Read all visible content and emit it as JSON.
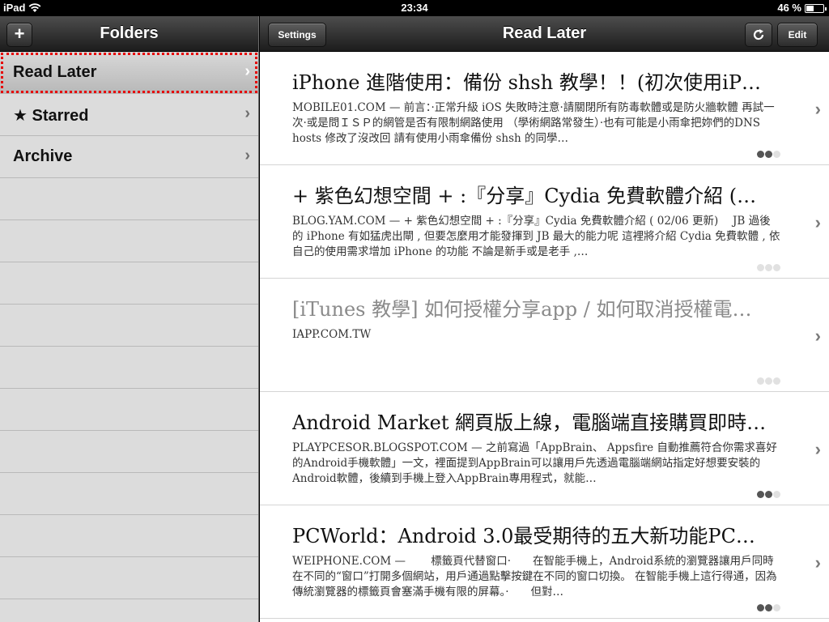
{
  "status": {
    "device": "iPad",
    "time": "23:34",
    "battery": "46 %",
    "battery_level": 0.46
  },
  "sidebar": {
    "title": "Folders",
    "add_label": "+",
    "items": [
      {
        "label": "Read Later",
        "selected": true
      },
      {
        "label": "★ Starred"
      },
      {
        "label": "Archive"
      }
    ]
  },
  "main": {
    "title": "Read Later",
    "settings_label": "Settings",
    "edit_label": "Edit",
    "articles": [
      {
        "title": "iPhone 進階使用：備份 shsh 教學！！(初次使用iP…",
        "source": "MOBILE01.COM",
        "summary": "前言：·正常升級 iOS 失敗時注意·請關閉所有防毒軟體或是防火牆軟體 再試一次·或是問ＩＳＰ的網管是否有限制網路使用 （學術網路常發生）·也有可能是小雨傘把妳們的DNS hosts 修改了沒改回 請有使用小雨傘備份 shsh 的同學…",
        "progress": 2
      },
      {
        "title": "+ 紫色幻想空間 + :『分享』Cydia 免費軟體介紹 (…",
        "source": "BLOG.YAM.COM",
        "summary": " + 紫色幻想空間 + :『分享』Cydia 免費軟體介紹 ( 02/06 更新)　 JB 過後的 iPhone 有如猛虎出閘 , 但要怎麼用才能發揮到 JB 最大的能力呢 這裡將介紹 Cydia 免費軟體 , 依自己的使用需求增加 iPhone 的功能 不論是新手或是老手 ,…",
        "progress": 0
      },
      {
        "title": "[iTunes 教學] 如何授權分享app / 如何取消授權電…",
        "source": "IAPP.COM.TW",
        "summary": "",
        "progress": 0,
        "read": true
      },
      {
        "title": "Android Market 網頁版上線，電腦端直接購買即時…",
        "source": "PLAYPCESOR.BLOGSPOT.COM",
        "summary": "之前寫過「AppBrain、 Appsfire 自動推薦符合你需求喜好的Android手機軟體」一文，裡面提到AppBrain可以讓用戶先透過電腦端網站指定好想要安裝的Android軟體，後續到手機上登入AppBrain專用程式，就能…",
        "progress": 2
      },
      {
        "title": "PCWorld：Android 3.0最受期待的五大新功能PC…",
        "source": "WEIPHONE.COM",
        "summary": "　　標籤頁代替窗口·　　在智能手機上，Android系統的瀏覽器讓用戶同時在不同的“窗口”打開多個網站，用戶通過點擊按鍵在不同的窗口切換。 在智能手機上這行得通，因為傳統瀏覽器的標籤頁會塞滿手機有限的屏幕。·　　但對…",
        "progress": 2
      }
    ]
  }
}
